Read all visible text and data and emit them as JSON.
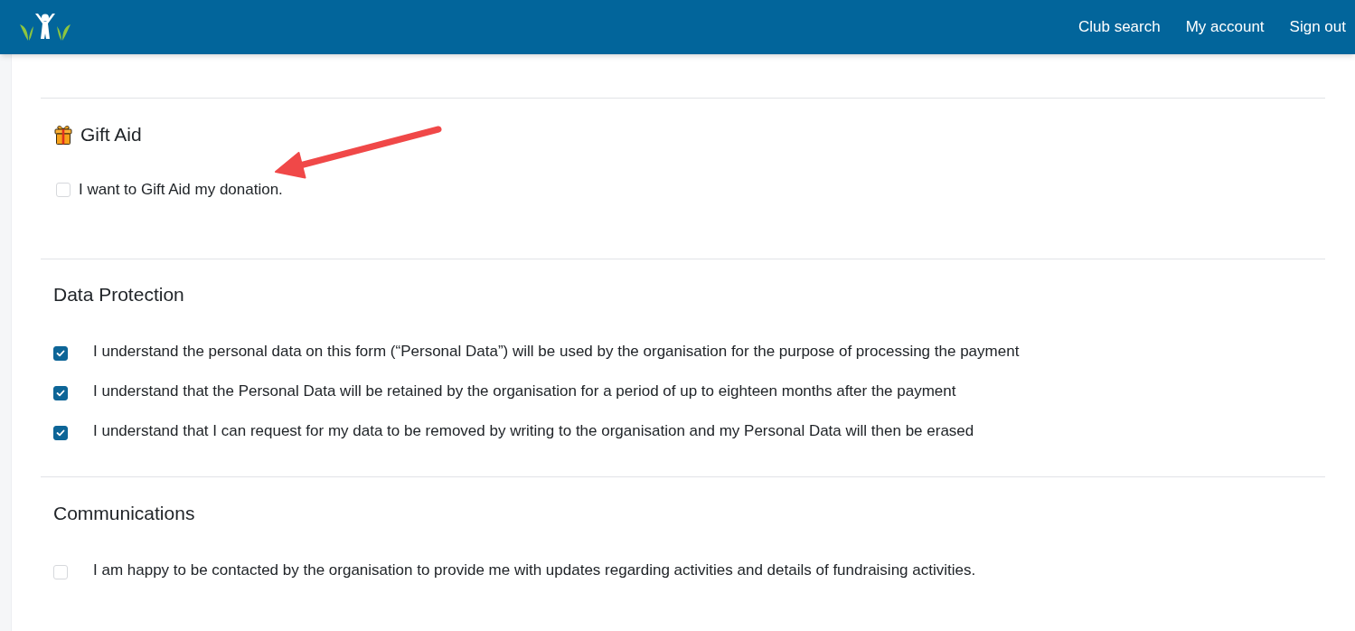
{
  "header": {
    "nav": [
      {
        "label": "Club search"
      },
      {
        "label": "My account"
      },
      {
        "label": "Sign out"
      }
    ]
  },
  "sections": [
    {
      "kind": "with_icon",
      "title": "Gift Aid",
      "options": [
        {
          "label": "I want to Gift Aid my donation.",
          "checked": false
        }
      ]
    },
    {
      "kind": "plain",
      "title": "Data Protection",
      "options": [
        {
          "label": "I understand the personal data on this form (“Personal Data”) will be used by the organisation for the purpose of processing the payment",
          "checked": true
        },
        {
          "label": "I understand that the Personal Data will be retained by the organisation for a period of up to eighteen months after the payment",
          "checked": true
        },
        {
          "label": "I understand that I can request for my data to be removed by writing to the organisation and my Personal Data will then be erased",
          "checked": true
        }
      ]
    },
    {
      "kind": "plain",
      "title": "Communications",
      "options": [
        {
          "label": "I am happy to be contacted by the organisation to provide me with updates regarding activities and details of fundraising activities.",
          "checked": false
        }
      ]
    }
  ],
  "annotations": [
    {
      "kind": "arrow"
    }
  ]
}
